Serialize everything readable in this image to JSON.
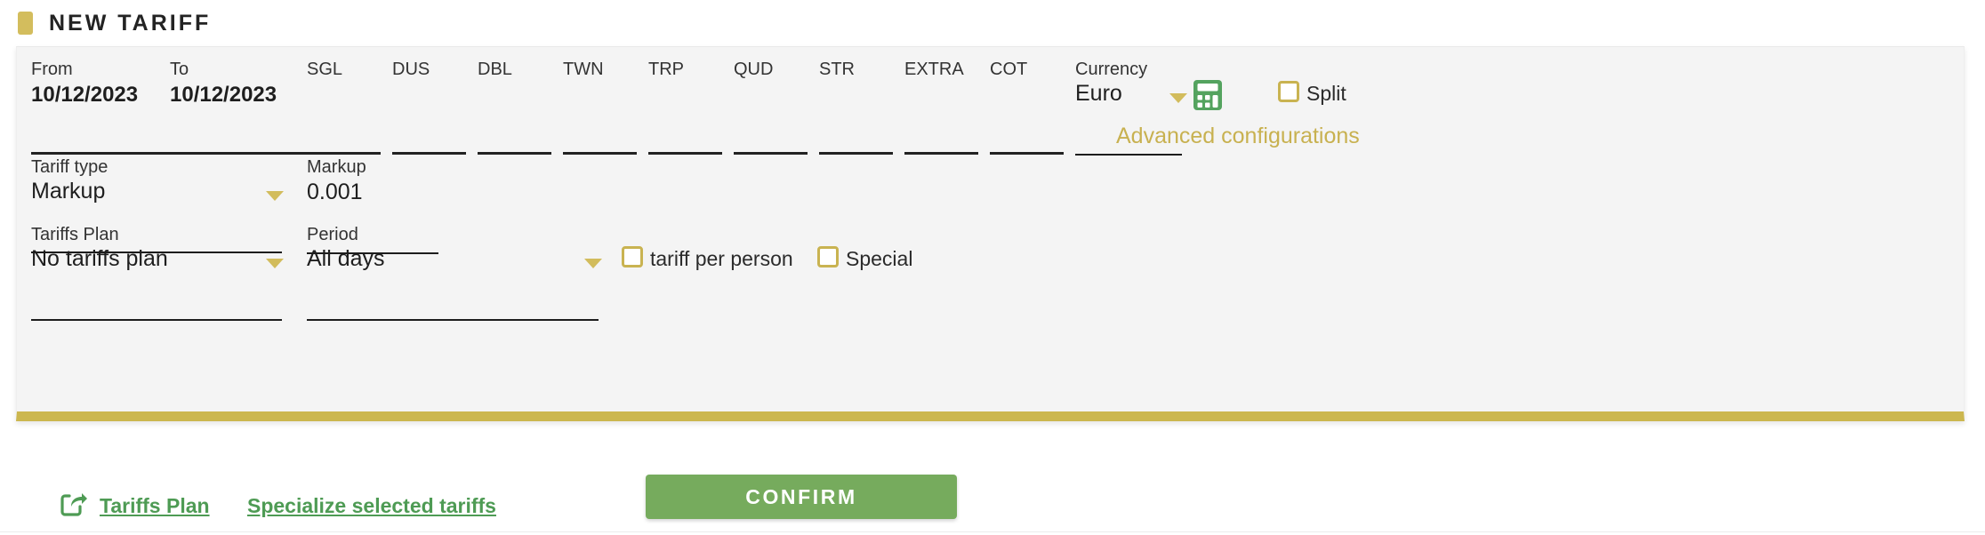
{
  "header": {
    "title": "NEW TARIFF",
    "accent_color": "#d3bd5d"
  },
  "form": {
    "date_from": {
      "label": "From",
      "value": "10/12/2023"
    },
    "date_to": {
      "label": "To",
      "value": "10/12/2023"
    },
    "occupancy_columns": [
      {
        "label": "SGL",
        "value": ""
      },
      {
        "label": "DUS",
        "value": ""
      },
      {
        "label": "DBL",
        "value": ""
      },
      {
        "label": "TWN",
        "value": ""
      },
      {
        "label": "TRP",
        "value": ""
      },
      {
        "label": "QUD",
        "value": ""
      },
      {
        "label": "STR",
        "value": ""
      },
      {
        "label": "EXTRA",
        "value": ""
      },
      {
        "label": "COT",
        "value": ""
      }
    ],
    "currency": {
      "label": "Currency",
      "value": "Euro"
    },
    "calculator_icon": "calculator-icon",
    "split": {
      "label": "Split",
      "checked": false
    },
    "advanced_configurations": "Advanced configurations",
    "tariff_type": {
      "label": "Tariff type",
      "value": "Markup"
    },
    "markup": {
      "label": "Markup",
      "value": "0.001"
    },
    "tariffs_plan": {
      "label": "Tariffs Plan",
      "value": "No tariffs plan"
    },
    "period": {
      "label": "Period",
      "value": "All days"
    },
    "tariff_per_person": {
      "label": "tariff per person",
      "checked": false
    },
    "special": {
      "label": "Special",
      "checked": false
    }
  },
  "footer": {
    "share_icon": "share-arrow-icon",
    "tariffs_plan_link": "Tariffs Plan",
    "specialize_link": "Specialize selected tariffs",
    "confirm_button": "CONFIRM"
  },
  "colors": {
    "gold": "#ccb74f",
    "green": "#76ab5d",
    "link_green": "#4e9b54",
    "card_bg": "#f4f4f4"
  }
}
